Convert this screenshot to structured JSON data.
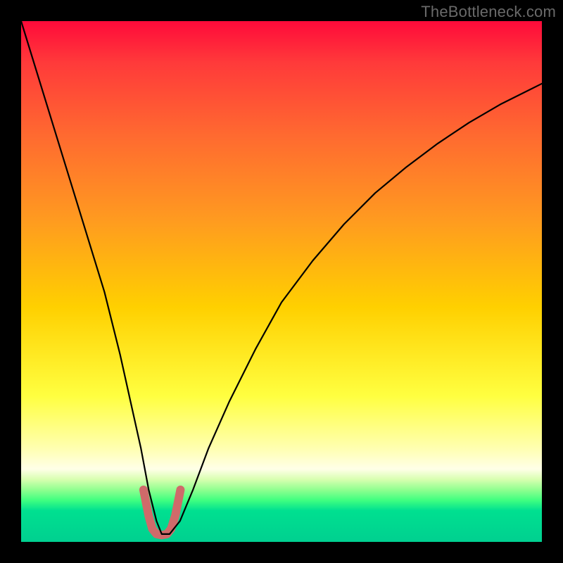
{
  "watermark": "TheBottleneck.com",
  "chart_data": {
    "type": "line",
    "title": "",
    "xlabel": "",
    "ylabel": "",
    "xlim": [
      0,
      100
    ],
    "ylim": [
      0,
      100
    ],
    "background_gradient": {
      "top": "#ff0a3a",
      "mid_upper": "#ff9a20",
      "mid": "#ffff40",
      "lower": "#90ff90",
      "bottom": "#00d090"
    },
    "series": [
      {
        "name": "bottleneck-curve",
        "color": "#000000",
        "x": [
          0,
          4,
          8,
          12,
          16,
          19,
          21,
          23,
          24.5,
          26,
          27,
          28.5,
          30.5,
          33,
          36,
          40,
          45,
          50,
          56,
          62,
          68,
          74,
          80,
          86,
          92,
          100
        ],
        "y": [
          100,
          87,
          74,
          61,
          48,
          36,
          27,
          18,
          10,
          4,
          1.5,
          1.5,
          4,
          10,
          18,
          27,
          37,
          46,
          54,
          61,
          67,
          72,
          76.5,
          80.5,
          84,
          88
        ]
      },
      {
        "name": "highlight-u",
        "color": "#cf6a6a",
        "stroke_width": 12,
        "x": [
          23.5,
          24.5,
          25.2,
          26,
          27,
          28,
          28.8,
          29.6,
          30.6
        ],
        "y": [
          10,
          5,
          2.5,
          1.5,
          1.3,
          1.5,
          2.5,
          5,
          10
        ]
      }
    ]
  }
}
